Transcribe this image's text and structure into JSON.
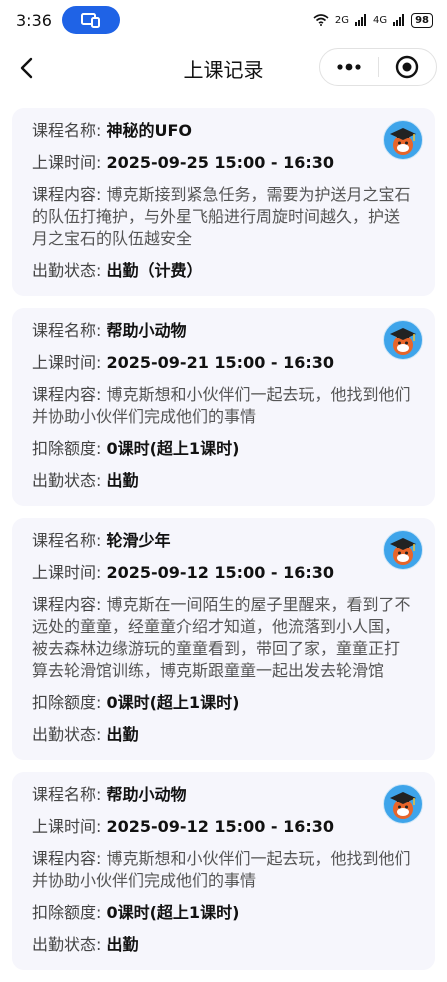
{
  "status": {
    "time": "3:36",
    "net1": "2G",
    "net2": "4G",
    "battery": "98"
  },
  "nav": {
    "title": "上课记录"
  },
  "labels": {
    "name": "课程名称: ",
    "time": "上课时间: ",
    "content": "课程内容: ",
    "deduct": "扣除额度: ",
    "attendance": "出勤状态: "
  },
  "records": [
    {
      "name": "神秘的UFO",
      "time": "2025-09-25 15:00 - 16:30",
      "content": "博克斯接到紧急任务，需要为护送月之宝石的队伍打掩护，与外星飞船进行周旋时间越久，护送月之宝石的队伍越安全",
      "attendance": "出勤（计费）"
    },
    {
      "name": "帮助小动物",
      "time": "2025-09-21 15:00 - 16:30",
      "content": "博克斯想和小伙伴们一起去玩，他找到他们并协助小伙伴们完成他们的事情",
      "deduct": "0课时(超上1课时)",
      "attendance": "出勤"
    },
    {
      "name": "轮滑少年",
      "time": "2025-09-12 15:00 - 16:30",
      "content": "博克斯在一间陌生的屋子里醒来，看到了不远处的童童，经童童介绍才知道，他流落到小人国，被去森林边缘游玩的童童看到，带回了家，童童正打算去轮滑馆训练，博克斯跟童童一起出发去轮滑馆",
      "deduct": "0课时(超上1课时)",
      "attendance": "出勤"
    },
    {
      "name": "帮助小动物",
      "time": "2025-09-12 15:00 - 16:30",
      "content": "博克斯想和小伙伴们一起去玩，他找到他们并协助小伙伴们完成他们的事情",
      "deduct": "0课时(超上1课时)",
      "attendance": "出勤"
    }
  ]
}
